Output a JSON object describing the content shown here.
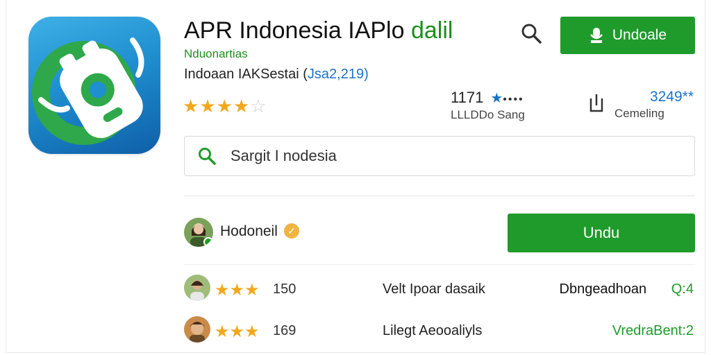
{
  "app": {
    "title_main": "APR Indonesia IAPlo",
    "title_accent": "dalil",
    "developer": "Nduonartias",
    "meta_text": "Indoaan IAKSestai (",
    "meta_value": "Jsa2,219",
    "meta_close": ")",
    "rating_stars": 3.5
  },
  "header": {
    "install_label": "Undoale",
    "search_icon": "search-icon",
    "mic_icon": "mic-icon"
  },
  "stats": {
    "rating_count": "1171",
    "rating_star": "★",
    "rating_dots": "••••",
    "rating_label": "LLLDDo Sang",
    "downloads": "3249**",
    "downloads_label": "Cemeling"
  },
  "search": {
    "value": "Sargit I nodesia"
  },
  "developer_row": {
    "name": "Hodoneil",
    "verified_badge": "✓",
    "button_label": "Undu"
  },
  "reviews": [
    {
      "stars": "★★★",
      "count": "150",
      "text": "Velt Ipoar dasaik",
      "right_text": "Dbngeadhoan",
      "right_value": "Q:4"
    },
    {
      "stars": "★★★",
      "count": "169",
      "text": "Lilegt Aeooaliyls",
      "right_text": "VredraBent:2",
      "right_value": ""
    }
  ],
  "colors": {
    "accent_green": "#1f9b2b",
    "link_blue": "#1a73c8",
    "star_gold": "#f2a81d"
  }
}
